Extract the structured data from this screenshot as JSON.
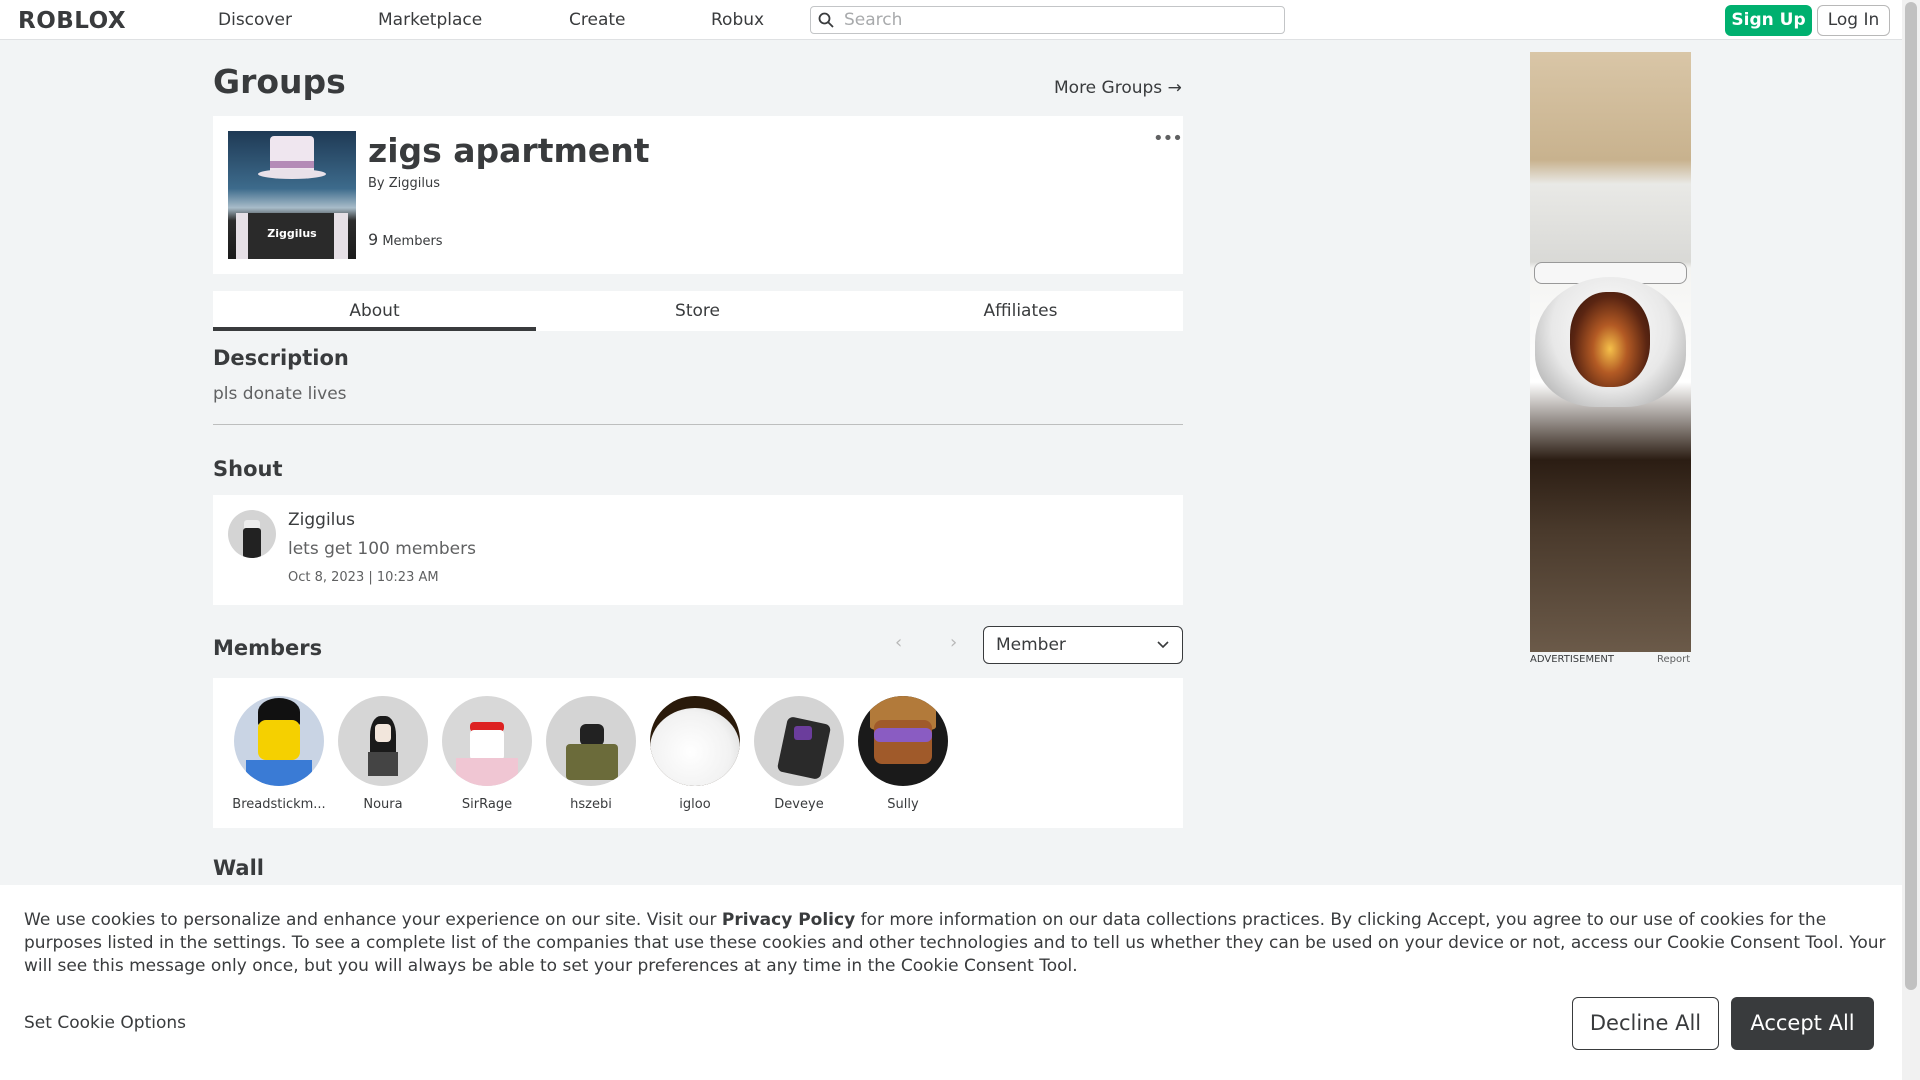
{
  "nav": {
    "logo": "ROBLOX",
    "links": [
      "Discover",
      "Marketplace",
      "Create",
      "Robux"
    ],
    "search_placeholder": "Search",
    "signup_label": "Sign Up",
    "login_label": "Log In"
  },
  "page": {
    "title": "Groups",
    "more_groups": "More Groups →"
  },
  "group": {
    "name": "zigs apartment",
    "by_prefix": "By",
    "owner": "Ziggilus",
    "member_count": "9",
    "members_label": "Members",
    "thumb_text": "Ziggilus",
    "menu": "•••"
  },
  "tabs": [
    "About",
    "Store",
    "Affiliates"
  ],
  "description": {
    "title": "Description",
    "text": "pls donate lives"
  },
  "shout": {
    "title": "Shout",
    "user": "Ziggilus",
    "text": "lets get 100 members",
    "date": "Oct 8, 2023 | 10:23 AM"
  },
  "members": {
    "title": "Members",
    "role_selected": "Member",
    "prev": "‹",
    "next": "›",
    "list": [
      {
        "name": "Breadstickm...",
        "color": "#3a7bd5"
      },
      {
        "name": "Noura",
        "color": "#cfcfcf"
      },
      {
        "name": "SirRage",
        "color": "#e8c6cf"
      },
      {
        "name": "hszebi",
        "color": "#6b6b3a"
      },
      {
        "name": "igloo",
        "color": "#f0f0f0"
      },
      {
        "name": "Deveye",
        "color": "#2a2a2a"
      },
      {
        "name": "Sully",
        "color": "#7a4a2a"
      }
    ]
  },
  "wall": {
    "title": "Wall"
  },
  "ad": {
    "label": "ADVERTISEMENT",
    "report": "Report"
  },
  "cookie": {
    "text_before": "We use cookies to personalize and enhance your experience on our site. Visit our ",
    "privacy_link": "Privacy Policy",
    "text_after": " for more information on our data collections practices. By clicking Accept, you agree to our use of cookies for the purposes listed in the settings. To see a complete list of the companies that use these cookies and other technologies and to tell us whether they can be used on your device or not, access our Cookie Consent Tool. Your will see this message only once, but you will always be able to set your preferences at any time in the Cookie Consent Tool.",
    "set_options": "Set Cookie Options",
    "decline": "Decline All",
    "accept": "Accept All"
  }
}
